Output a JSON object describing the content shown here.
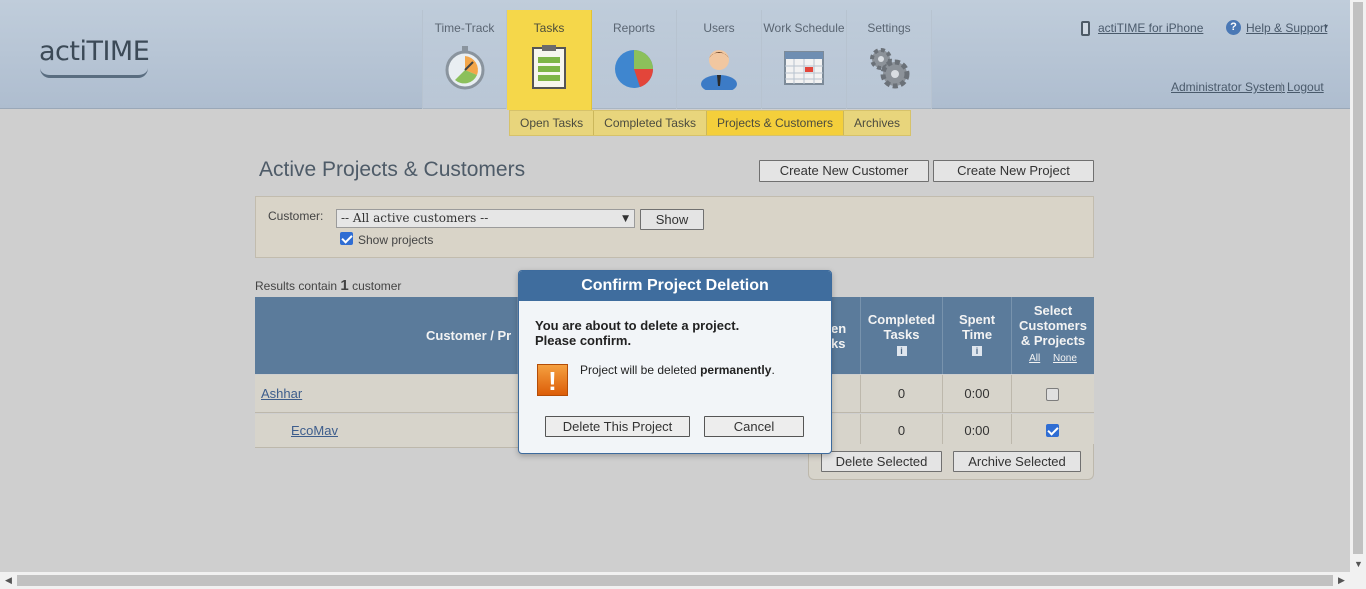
{
  "app": {
    "logo": "actiTIME"
  },
  "nav": {
    "tabs": [
      {
        "label": "Time-Track",
        "icon": "stopwatch-icon"
      },
      {
        "label": "Tasks",
        "icon": "clipboard-icon"
      },
      {
        "label": "Reports",
        "icon": "pie-chart-icon"
      },
      {
        "label": "Users",
        "icon": "user-icon"
      },
      {
        "label": "Work Schedule",
        "icon": "calendar-icon"
      },
      {
        "label": "Settings",
        "icon": "gears-icon"
      }
    ],
    "active_tab": "Tasks"
  },
  "top_right": {
    "iphone_link": "actiTIME for iPhone",
    "help_link": "Help & Support",
    "user_link": "Administrator System",
    "logout_link": "Logout"
  },
  "sub_nav": {
    "tabs": [
      "Open Tasks",
      "Completed Tasks",
      "Projects & Customers",
      "Archives"
    ],
    "active": "Projects & Customers"
  },
  "page": {
    "title": "Active Projects & Customers",
    "create_customer_button": "Create New Customer",
    "create_project_button": "Create New Project"
  },
  "filter": {
    "customer_label": "Customer:",
    "customer_select_value": "-- All active customers --",
    "show_button": "Show",
    "show_projects_label": "Show projects",
    "show_projects_checked": true
  },
  "results": {
    "prefix": "Results contain",
    "count": "1",
    "suffix": "customer"
  },
  "table": {
    "headers": {
      "customer_project": "Customer / Pr",
      "open_tasks_partial_1": "en",
      "open_tasks_partial_2": "ks",
      "completed_tasks_1": "Completed",
      "completed_tasks_2": "Tasks",
      "spent_time_1": "Spent",
      "spent_time_2": "Time",
      "select_1": "Select",
      "select_2": "Customers",
      "select_3": "& Projects",
      "select_all": "All",
      "select_none": "None"
    },
    "rows": [
      {
        "name": "Ashhar",
        "completed": "0",
        "spent": "0:00",
        "checked": false
      },
      {
        "name": "EcoMav",
        "completed": "0",
        "spent": "0:00",
        "checked": true
      }
    ],
    "delete_selected_button": "Delete Selected",
    "archive_selected_button": "Archive Selected"
  },
  "modal": {
    "title": "Confirm Project Deletion",
    "message_line1": "You are about to delete a project.",
    "message_line2": "Please confirm.",
    "warning_prefix": "Project will be deleted",
    "warning_bold": "permanently",
    "warning_suffix": ".",
    "warning_icon": "!",
    "delete_button": "Delete This Project",
    "cancel_button": "Cancel"
  }
}
